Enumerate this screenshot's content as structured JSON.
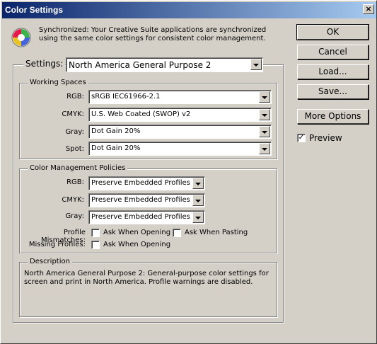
{
  "window": {
    "title": "Color Settings",
    "close_label": "×"
  },
  "sync": {
    "icon": "color-wheel-icon",
    "text": "Synchronized: Your Creative Suite applications are synchronized using the same color settings for consistent color management."
  },
  "settings": {
    "label": "Settings:",
    "value": "North America General Purpose 2"
  },
  "working_spaces": {
    "title": "Working Spaces",
    "rgb_label": "RGB:",
    "rgb_value": "sRGB IEC61966-2.1",
    "cmyk_label": "CMYK:",
    "cmyk_value": "U.S. Web Coated (SWOP) v2",
    "gray_label": "Gray:",
    "gray_value": "Dot Gain 20%",
    "spot_label": "Spot:",
    "spot_value": "Dot Gain 20%"
  },
  "policies": {
    "title": "Color Management Policies",
    "rgb_label": "RGB:",
    "rgb_value": "Preserve Embedded Profiles",
    "cmyk_label": "CMYK:",
    "cmyk_value": "Preserve Embedded Profiles",
    "gray_label": "Gray:",
    "gray_value": "Preserve Embedded Profiles",
    "mismatch_label": "Profile Mismatches:",
    "ask_opening_label": "Ask When Opening",
    "ask_pasting_label": "Ask When Pasting",
    "missing_label": "Missing Profiles:",
    "missing_opening_label": "Ask When Opening"
  },
  "description": {
    "title": "Description",
    "text": "North America General Purpose 2:  General-purpose color settings for screen and print in North America. Profile warnings are disabled."
  },
  "buttons": {
    "ok": "OK",
    "cancel": "Cancel",
    "load": "Load...",
    "save": "Save...",
    "more_options": "More Options"
  },
  "preview": {
    "label": "Preview",
    "checked_mark": "✓"
  }
}
